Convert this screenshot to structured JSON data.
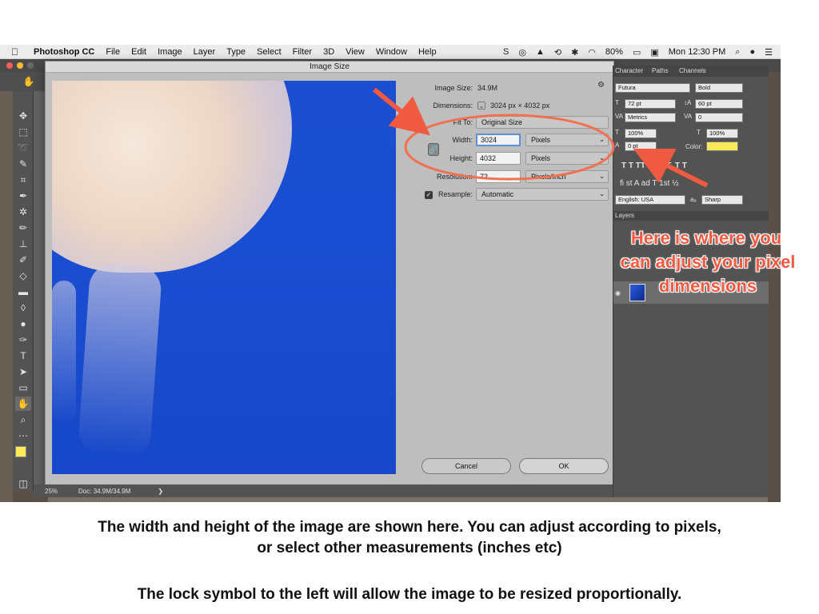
{
  "menubar": {
    "app": "Photoshop CC",
    "items": [
      "File",
      "Edit",
      "Image",
      "Layer",
      "Type",
      "Select",
      "Filter",
      "3D",
      "View",
      "Window",
      "Help"
    ],
    "battery": "80%",
    "clock": "Mon 12:30 PM"
  },
  "dialog": {
    "title": "Image Size",
    "image_size_label": "Image Size:",
    "image_size_value": "34.9M",
    "dimensions_label": "Dimensions:",
    "dimensions_value": "3024 px  ×  4032 px",
    "fit_to_label": "Fit To:",
    "fit_to_value": "Original Size",
    "width_label": "Width:",
    "width_value": "3024",
    "width_unit": "Pixels",
    "height_label": "Height:",
    "height_value": "4032",
    "height_unit": "Pixels",
    "resolution_label": "Resolution:",
    "resolution_value": "72",
    "resolution_unit": "Pixels/Inch",
    "resample_label": "Resample:",
    "resample_value": "Automatic",
    "cancel": "Cancel",
    "ok": "OK"
  },
  "status": {
    "zoom": "25%",
    "doc": "Doc: 34.9M/34.9M"
  },
  "panel": {
    "tabs": [
      "Character",
      "Paths",
      "Channels"
    ],
    "font": "Futura",
    "style": "Bold",
    "size": "72 pt",
    "leading": "60 pt",
    "kerning": "Metrics",
    "tracking": "0",
    "vscale": "100%",
    "hscale": "100%",
    "baseline": "0 pt",
    "color_label": "Color:",
    "language": "English: USA",
    "antialias_symbol": "aₐ",
    "antialias": "Sharp",
    "layers_tab": "Layers"
  },
  "annotation": {
    "line1": "Here is where you",
    "line2": "can adjust your pixel",
    "line3": "dimensions"
  },
  "caption": {
    "line1": "The width and height of the image are shown here. You can adjust according to pixels,",
    "line2": "or select other measurements (inches etc)",
    "line3": "The lock symbol to the left will allow the image to be resized proportionally."
  },
  "colors": {
    "annotation": "#ef5a40",
    "swatch": "#fcea5a",
    "dialog_bg": "#bebebe"
  }
}
